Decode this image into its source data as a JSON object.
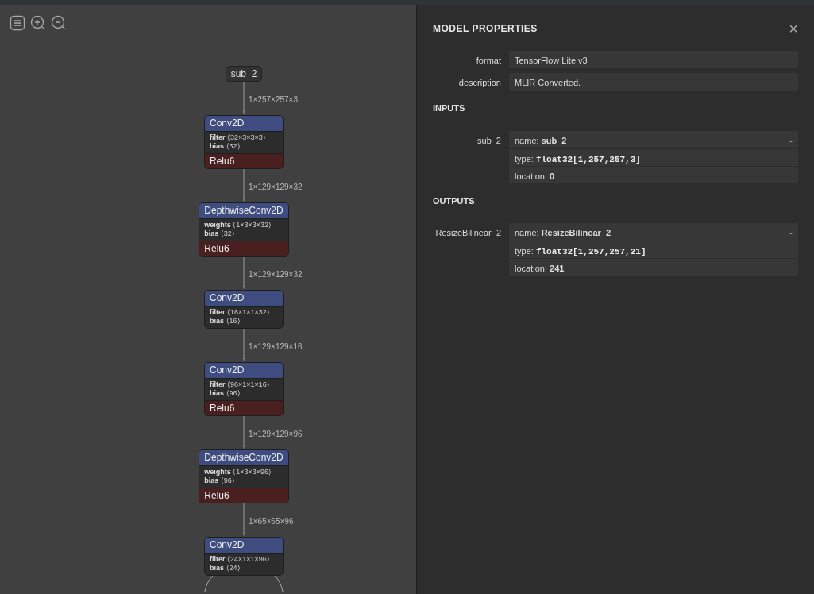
{
  "toolbar": {
    "buttons": [
      {
        "kind": "menu"
      },
      {
        "kind": "zoom-in"
      },
      {
        "kind": "zoom-out"
      }
    ]
  },
  "graph": {
    "nodes": [
      {
        "kind": "input",
        "label": "sub_2",
        "output_shape": "1×257×257×3"
      },
      {
        "kind": "op",
        "type": "Conv2D",
        "attributes": [
          {
            "name": "filter",
            "value": "⟨32×3×3×3⟩"
          },
          {
            "name": "bias",
            "value": "⟨32⟩"
          }
        ],
        "activation": "Relu6",
        "output_shape": "1×129×129×32"
      },
      {
        "kind": "op",
        "type": "DepthwiseConv2D",
        "attributes": [
          {
            "name": "weights",
            "value": "⟨1×3×3×32⟩"
          },
          {
            "name": "bias",
            "value": "⟨32⟩"
          }
        ],
        "activation": "Relu6",
        "output_shape": "1×129×129×32"
      },
      {
        "kind": "op",
        "type": "Conv2D",
        "attributes": [
          {
            "name": "filter",
            "value": "⟨16×1×1×32⟩"
          },
          {
            "name": "bias",
            "value": "⟨16⟩"
          }
        ],
        "output_shape": "1×129×129×16"
      },
      {
        "kind": "op",
        "type": "Conv2D",
        "attributes": [
          {
            "name": "filter",
            "value": "⟨96×1×1×16⟩"
          },
          {
            "name": "bias",
            "value": "⟨96⟩"
          }
        ],
        "activation": "Relu6",
        "output_shape": "1×129×129×96"
      },
      {
        "kind": "op",
        "type": "DepthwiseConv2D",
        "attributes": [
          {
            "name": "weights",
            "value": "⟨1×3×3×96⟩"
          },
          {
            "name": "bias",
            "value": "⟨96⟩"
          }
        ],
        "activation": "Relu6",
        "output_shape": "1×65×65×96"
      },
      {
        "kind": "op",
        "type": "Conv2D",
        "attributes": [
          {
            "name": "filter",
            "value": "⟨24×1×1×96⟩"
          },
          {
            "name": "bias",
            "value": "⟨24⟩"
          }
        ]
      }
    ]
  },
  "panel": {
    "title": "MODEL PROPERTIES",
    "close": "×",
    "properties": [
      {
        "label": "format",
        "value": "TensorFlow Lite v3"
      },
      {
        "label": "description",
        "value": "MLIR Converted."
      }
    ],
    "sections": [
      {
        "title": "INPUTS",
        "items": [
          {
            "name": "sub_2",
            "toggle": "-",
            "fields": [
              {
                "label": "name:",
                "value": "sub_2",
                "kind": "bold"
              },
              {
                "label": "type:",
                "value": "float32[1,257,257,3]",
                "kind": "code"
              },
              {
                "label": "location:",
                "value": "0",
                "kind": "bold"
              }
            ]
          }
        ]
      },
      {
        "title": "OUTPUTS",
        "items": [
          {
            "name": "ResizeBilinear_2",
            "toggle": "-",
            "fields": [
              {
                "label": "name:",
                "value": "ResizeBilinear_2",
                "kind": "bold"
              },
              {
                "label": "type:",
                "value": "float32[1,257,257,21]",
                "kind": "code"
              },
              {
                "label": "location:",
                "value": "241",
                "kind": "bold"
              }
            ]
          }
        ]
      }
    ]
  }
}
